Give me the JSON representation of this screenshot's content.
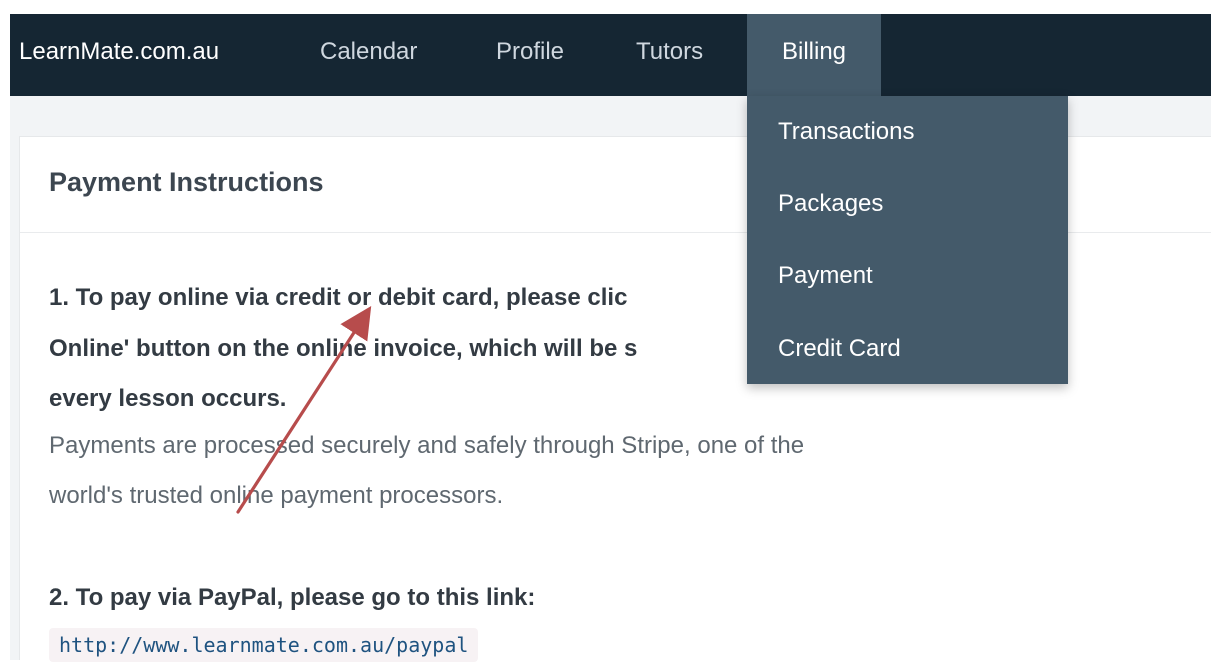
{
  "navbar": {
    "brand": "LearnMate.com.au",
    "items": [
      {
        "label": "Calendar"
      },
      {
        "label": "Profile"
      },
      {
        "label": "Tutors"
      },
      {
        "label": "Billing"
      }
    ]
  },
  "billing_menu": {
    "items": [
      {
        "label": "Transactions"
      },
      {
        "label": "Packages"
      },
      {
        "label": "Payment"
      },
      {
        "label": "Credit Card"
      }
    ]
  },
  "panel": {
    "title": "Payment Instructions",
    "instruction_1": {
      "line_1": "1. To pay online via credit or debit card, please clic",
      "line_2": "Online' button on the online invoice, which will be s",
      "line_3": "every lesson occurs.",
      "detail_1": "Payments are processed securely and safely through Stripe, one of the",
      "detail_2": "world's trusted online payment processors."
    },
    "instruction_2": {
      "text": "2. To pay via PayPal, please go to this link:",
      "link": "http://www.learnmate.com.au/paypal"
    }
  },
  "colors": {
    "navbar_bg": "#152633",
    "active_bg": "#445a6a",
    "arrow": "#b74c4c"
  }
}
